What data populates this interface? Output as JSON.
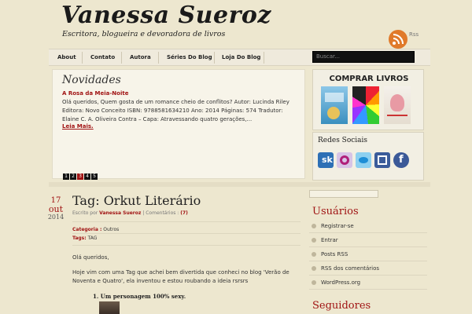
{
  "site": {
    "title": "Vanessa Sueroz",
    "description": "Escritora, blogueira e devoradora de livros",
    "rss_label": "Rss"
  },
  "nav": {
    "items": [
      "About",
      "Contato",
      "Autora",
      "Séries Do Blog",
      "Loja Do Blog"
    ],
    "search_placeholder": "Buscar..."
  },
  "featured": {
    "heading": "Novidades",
    "link_title": "A Rosa da Meia-Noite",
    "text": "Olá queridos, Quem gosta de um romance cheio de conflitos? Autor: Lucinda Riley Editora: Novo Conceito ISBN:  9788581634210 Ano: 2014 Páginas: 574 Tradutor: Elaine C. A. Oliveira Contra – Capa: Atravessando quatro gerações,...",
    "more": "Leia Mais.",
    "pages": [
      "1",
      "2",
      "3",
      "4",
      "5"
    ],
    "active_page": 3
  },
  "widgets": {
    "books_title": "COMPRAR LIVROS",
    "social_title": "Redes Sociais",
    "social_icons": [
      "skoob-icon",
      "orkut-icon",
      "twitter-icon",
      "blog-icon",
      "facebook-icon"
    ]
  },
  "post": {
    "date_day": "17",
    "date_month": "out",
    "date_year": "2014",
    "title": "Tag: Orkut Literário",
    "meta_prefix": "Escrito por",
    "meta_author": "Vanessa Sueroz",
    "meta_comments": "| Comentários :",
    "meta_comment_count": "(7)",
    "category_label": "Categoria :",
    "category_value": "Outros",
    "tags_label": "Tags:",
    "tags_value": "TAG",
    "greeting": "Olá queridos,",
    "body": "Hoje vim com uma Tag que achei bem divertida que conheci no blog 'Verão de Noventa e Quatro', ela inventou e estou roubando a ideia rsrsrs",
    "item_1": "1.   Um personagem 100% sexy."
  },
  "sidebar": {
    "users_heading": "Usuários",
    "users_items": [
      "Registrar-se",
      "Entrar",
      "Posts RSS",
      "RSS dos comentários",
      "WordPress.org"
    ],
    "followers_heading": "Seguidores"
  },
  "colors": {
    "accent": "#a01313",
    "background": "#ede7cf",
    "search_bg": "#111111"
  }
}
